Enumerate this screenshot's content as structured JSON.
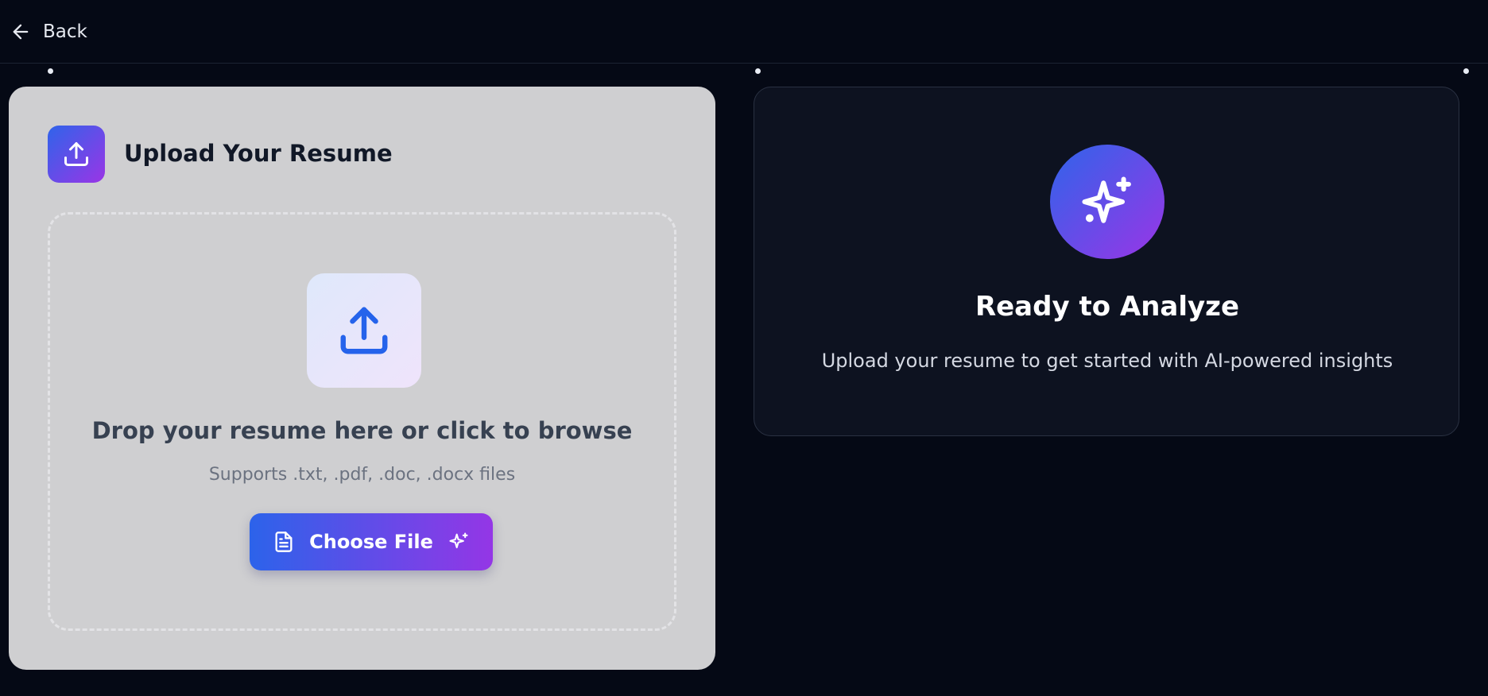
{
  "nav": {
    "back_label": "Back"
  },
  "upload": {
    "title": "Upload Your Resume",
    "drop_text": "Drop your resume here or click to browse",
    "supported_text": "Supports .txt, .pdf, .doc, .docx files",
    "button_label": "Choose File"
  },
  "analyze": {
    "title": "Ready to Analyze",
    "subtitle": "Upload your resume to get started with AI-powered insights"
  },
  "icons": {
    "back": "arrow-left-icon",
    "header": "upload-icon",
    "dropzone": "upload-icon",
    "button_left": "file-text-icon",
    "button_right": "sparkles-icon",
    "analyze": "sparkles-icon"
  },
  "colors": {
    "background": "#050915",
    "upload_card": "#cfcfd1",
    "analyze_card": "#0d1220",
    "gradient_start": "#2f64ea",
    "gradient_end": "#9a35e6",
    "icon_blue": "#2563eb"
  }
}
